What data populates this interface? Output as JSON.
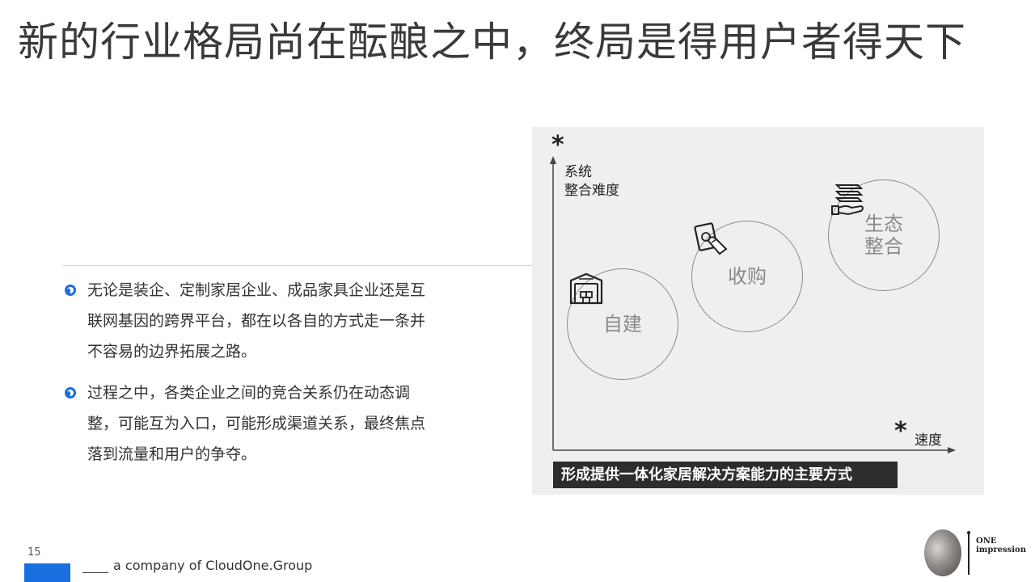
{
  "slide": {
    "title": "新的行业格局尚在酝酿之中，终局是得用户者得天下",
    "page_number": "15"
  },
  "bullets": [
    {
      "text": "无论是装企、定制家居企业、成品家具企业还是互联网基因的跨界平台，都在以各自的方式走一条并不容易的边界拓展之路。"
    },
    {
      "text": "过程之中，各类企业之间的竞合关系仍在动态调整，可能互为入口，可能形成渠道关系，最终焦点落到流量和用户的争夺。"
    }
  ],
  "diagram": {
    "y_axis_label": "系统\n整合难度",
    "x_axis_label": "速度",
    "asterisk": "*",
    "circles": [
      {
        "label": "自建",
        "icon": "warehouse-icon"
      },
      {
        "label": "收购",
        "icon": "hand-money-icon"
      },
      {
        "label": "生态\n整合",
        "icon": "hand-layers-icon"
      }
    ],
    "caption": "形成提供一体化家居解决方案能力的主要方式"
  },
  "footer": {
    "company": "a company of CloudOne.Group",
    "accent_color": "#1a6fe0"
  },
  "logo": {
    "line1": "ONE",
    "line2": "impression"
  }
}
